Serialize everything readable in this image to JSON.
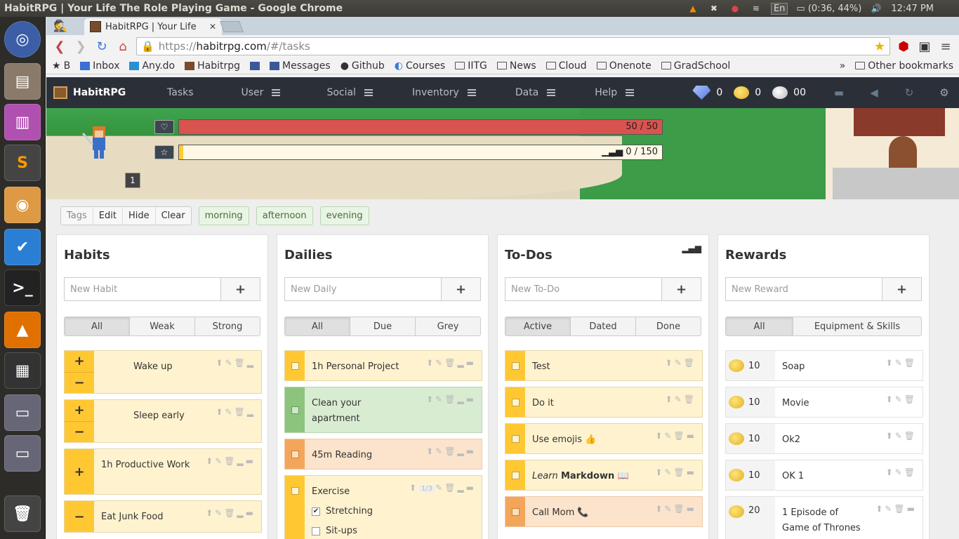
{
  "os": {
    "window_title": "HabitRPG | Your Life The Role Playing Game - Google Chrome",
    "lang": "En",
    "battery": "(0:36, 44%)",
    "time": "12:47 PM"
  },
  "browser": {
    "tab_title": "HabitRPG | Your Life",
    "url_scheme": "https://",
    "url_host": "habitrpg.com",
    "url_path": "/#/tasks",
    "bookmarks": [
      "B",
      "Inbox",
      "Any.do",
      "Habitrpg",
      "",
      "Messages",
      "Github",
      "Courses",
      "IITG",
      "News",
      "Cloud",
      "Onenote",
      "GradSchool"
    ],
    "other_bookmarks": "Other bookmarks",
    "overflow": "»"
  },
  "nav": {
    "brand": "HabitRPG",
    "items": [
      "Tasks",
      "User",
      "Social",
      "Inventory",
      "Data",
      "Help"
    ],
    "gems": "0",
    "gold": "0",
    "silver": "00"
  },
  "hero": {
    "level": "1",
    "hp_text": "50 / 50",
    "hp_fraction": 1.0,
    "xp_text": "0 / 150",
    "xp_fraction": 0.0
  },
  "tags": {
    "label": "Tags",
    "edit": "Edit",
    "hide": "Hide",
    "clear": "Clear",
    "list": [
      "morning",
      "afternoon",
      "evening"
    ]
  },
  "habits": {
    "title": "Habits",
    "placeholder": "New Habit",
    "add": "+",
    "filters": [
      "All",
      "Weak",
      "Strong"
    ],
    "items": [
      "Wake up",
      "Sleep early",
      "1h Productive Work",
      "Eat Junk Food"
    ]
  },
  "dailies": {
    "title": "Dailies",
    "placeholder": "New Daily",
    "add": "+",
    "filters": [
      "All",
      "Due",
      "Grey"
    ],
    "items": [
      "1h Personal Project",
      "Clean your apartment",
      "45m Reading",
      "Exercise"
    ],
    "checklist_count": "1/3",
    "checklist": [
      "Stretching",
      "Sit-ups"
    ]
  },
  "todos": {
    "title": "To-Dos",
    "placeholder": "New To-Do",
    "add": "+",
    "filters": [
      "Active",
      "Dated",
      "Done"
    ],
    "items": [
      "Test",
      "Do it",
      "Use emojis 👍",
      "Learn",
      "Markdown 📖",
      "Call Mom 📞"
    ]
  },
  "rewards": {
    "title": "Rewards",
    "placeholder": "New Reward",
    "add": "+",
    "filters": [
      "All",
      "Equipment & Skills"
    ],
    "items": [
      {
        "cost": "10",
        "name": "Soap"
      },
      {
        "cost": "10",
        "name": "Movie"
      },
      {
        "cost": "10",
        "name": "Ok2"
      },
      {
        "cost": "10",
        "name": "OK 1"
      },
      {
        "cost": "20",
        "name": "1 Episode of Game of Thrones"
      }
    ]
  }
}
